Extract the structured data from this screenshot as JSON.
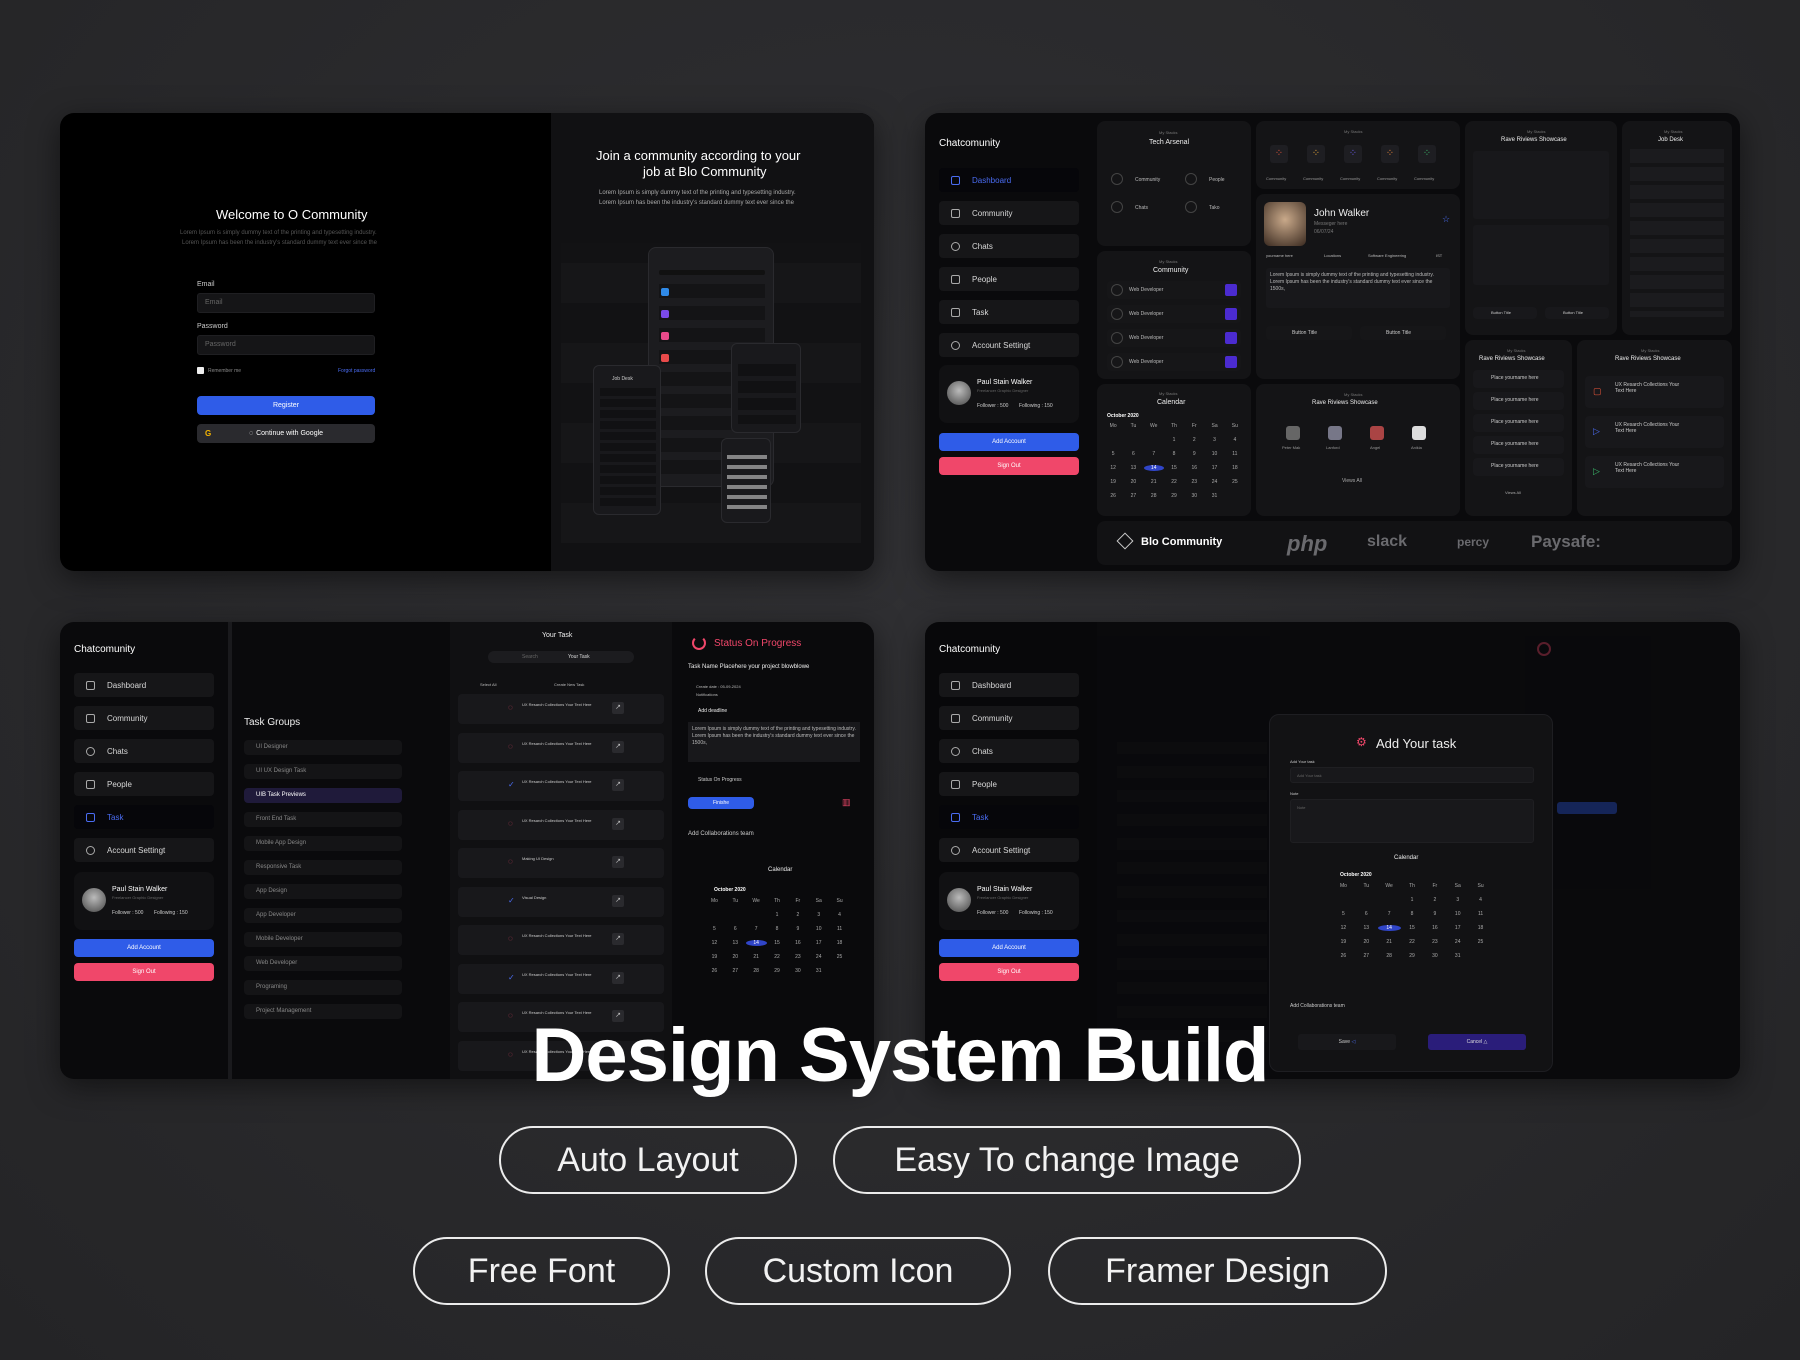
{
  "login": {
    "welcome": "Welcome to O Community",
    "lorem1": "Lorem Ipsum is simply dummy text of the printing and typesetting industry.",
    "lorem2": "Lorem Ipsum has been the industry's standard dummy text ever since the",
    "email_label": "Email",
    "email_placeholder": "Email",
    "password_label": "Password",
    "password_placeholder": "Password",
    "remember": "Remember me",
    "forgot": "Forgot password",
    "register": "Register",
    "google": "Continue with Google"
  },
  "join": {
    "title1": "Join a community according to your",
    "title2": "job at Blo Community",
    "lorem1": "Lorem Ipsum is simply dummy text of the printing and typesetting industry.",
    "lorem2": "Lorem Ipsum has been the industry's standard dummy text ever since the",
    "job_desk": "Job Desk"
  },
  "sidebar": {
    "brand": "Chatcomunity",
    "items": [
      "Dashboard",
      "Community",
      "Chats",
      "People",
      "Task",
      "Account Settingt"
    ],
    "user_name": "Paul Stain Walker",
    "user_role": "Freelancer Graphic Designer",
    "followers": "Follower : 500",
    "following": "Following : 150",
    "add_account": "Add Account",
    "sign_out": "Sign Out"
  },
  "dashboard": {
    "tech_arsenal": "Tech Arsenal",
    "my_stacks": "My Stacks",
    "arsenal_items": [
      "Community",
      "People",
      "Chats",
      "Tako"
    ],
    "portal_items": [
      "Community",
      "Community",
      "Community",
      "Community",
      "Community"
    ],
    "community": "Community",
    "web_dev": "Web Developer",
    "profile_name": "John Walker",
    "profile_sub": "Messeger here",
    "profile_date": "06/07/24",
    "tags": [
      "yourname here",
      "Locations",
      "Software Engineering",
      "IST"
    ],
    "profile_lorem": "Lorem Ipsum is simply dummy text of the printing and typesetting industry. Lorem Ipsum has been the industry's standard dummy text ever since the 1500s,",
    "button_title": "Button Title",
    "calendar": "Calendar",
    "month": "October 2020",
    "rave": "Rave Riviews Showcase",
    "rave_people": [
      "Peter Mak",
      "Lanford",
      "Angel",
      "Anikia"
    ],
    "views_all": "Views All",
    "job_desk": "Job Desk",
    "ux_research": "UX Resarch Collections Your Text Here",
    "place_name": "Place yourname here",
    "blo": "Blo Community",
    "logos": [
      "php",
      "slack",
      "percy",
      "Paysafe:"
    ]
  },
  "task": {
    "task_groups": "Task Groups",
    "groups": [
      "UI Designer",
      "UI UX Design Task",
      "UIB Task Previews",
      "Front End Task",
      "Mobile App Design",
      "Responsive Task",
      "App Design",
      "App Developer",
      "Mobile Developer",
      "Web Developer",
      "Programing",
      "Project Management"
    ],
    "your_task": "Your Task",
    "search": "Search",
    "select_all": "Select All",
    "create_new": "Create New Task",
    "task_items": [
      "UX Resarch Collections Your Text Here",
      "UX Resarch Collections Your Text Here",
      "UX Resarch Collections Your Text Here",
      "UX Resarch Collections Your Text Here",
      "Making UI Design",
      "Visual Design",
      "UX Resarch Collections Your Text Here",
      "UX Resarch Collections Your Text Here",
      "UX Resarch Collections Your Text Here",
      "UX Resarch Collections Your Text Here"
    ],
    "status": "Status On Progress",
    "task_name": "Task Name Placehere your project blowblowe",
    "created_date": "Create date : 05-09-2024",
    "notifications": "Notifications",
    "add_deadline": "Add deadline",
    "lorem": "Lorem Ipsum is simply dummy text of the printing and typesetting industry. Lorem Ipsum has been the industry's standard dummy text ever since the 1500s,",
    "status_small": "Status On Progress",
    "finish": "Finishe",
    "collab": "Add Collaborations team",
    "calendar": "Calendar",
    "month": "October 2020"
  },
  "addtask": {
    "title": "Add Your task",
    "add_label": "Add Your task",
    "add_placeholder": "Add Your task",
    "note_label": "Note",
    "note_placeholder": "Note",
    "calendar": "Calendar",
    "month": "October 2020",
    "collab": "Add Collaborations team",
    "save": "Save",
    "cancel": "Cancel"
  },
  "calendar_days": {
    "header": [
      "Mo",
      "Tu",
      "We",
      "Th",
      "Fr",
      "Sa",
      "Su"
    ],
    "cells": [
      "",
      "",
      "",
      "1",
      "2",
      "3",
      "4",
      "5",
      "6",
      "7",
      "8",
      "9",
      "10",
      "11",
      "12",
      "13",
      "14",
      "15",
      "16",
      "17",
      "18",
      "19",
      "20",
      "21",
      "22",
      "23",
      "24",
      "25",
      "26",
      "27",
      "28",
      "29",
      "30",
      "31",
      ""
    ],
    "selected": "14"
  },
  "hero": {
    "title": "Design System Build",
    "pills": [
      "Auto Layout",
      "Easy To change Image",
      "Free Font",
      "Custom Icon",
      "Framer Design"
    ]
  },
  "colors": {
    "accent": "#2f5ce8",
    "danger": "#f0476a",
    "purple": "#4b2bd0",
    "bg": "#2a2a2c"
  }
}
